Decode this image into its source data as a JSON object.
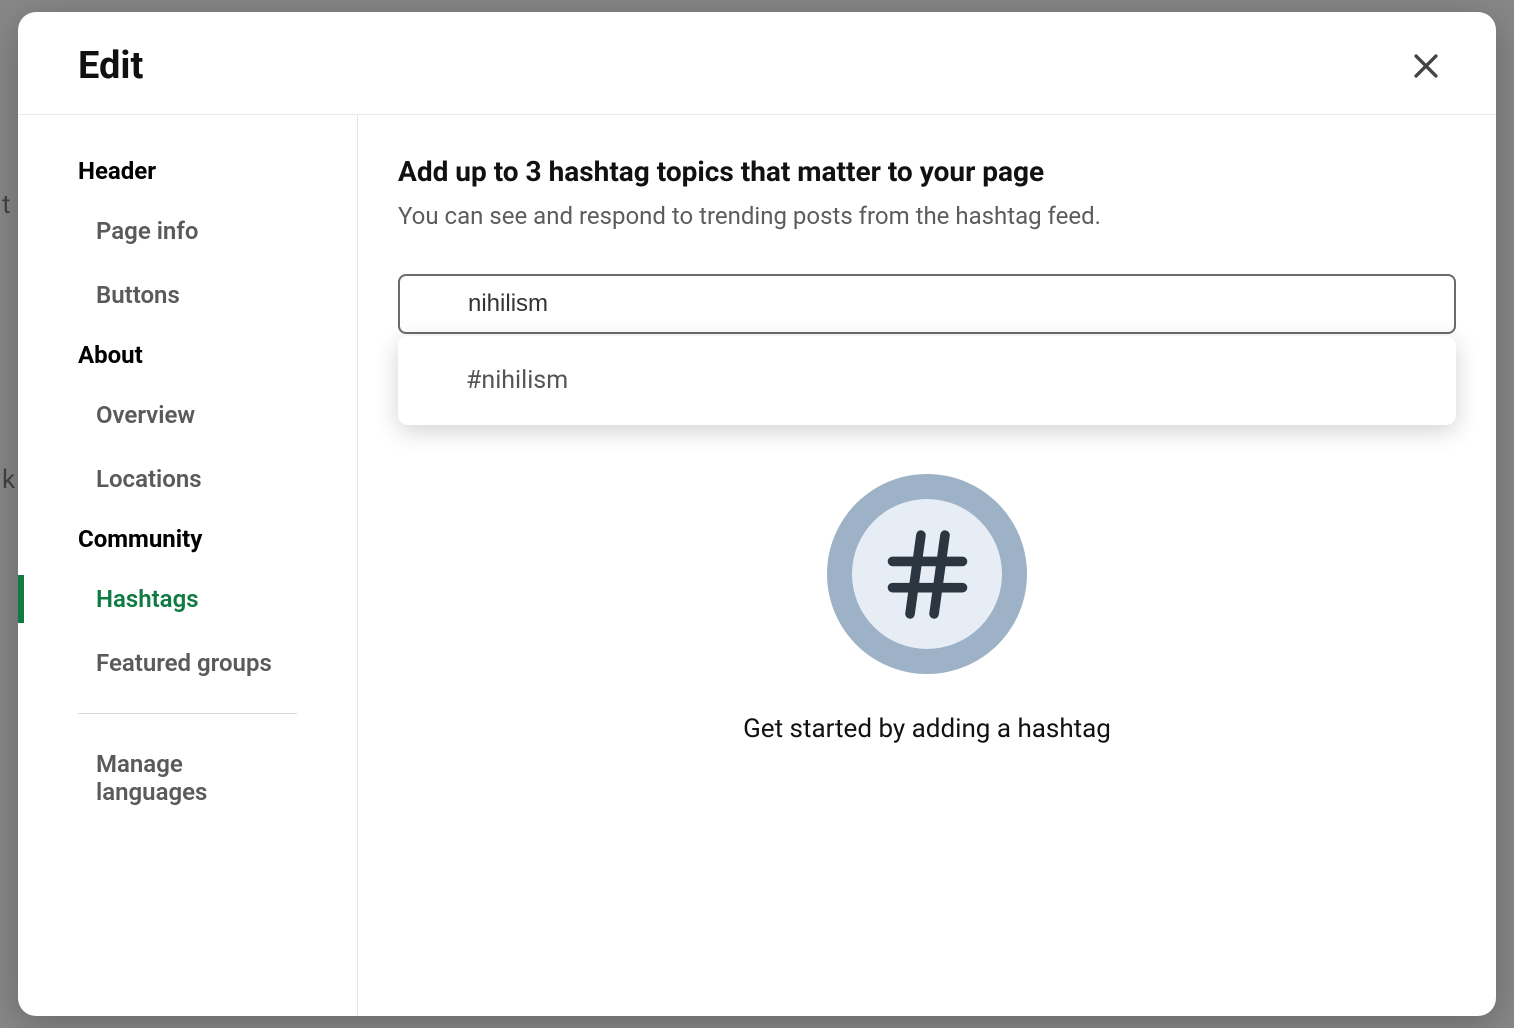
{
  "modal": {
    "title": "Edit"
  },
  "sidebar": {
    "sections": [
      {
        "header": "Header",
        "items": [
          {
            "label": "Page info",
            "active": false
          },
          {
            "label": "Buttons",
            "active": false
          }
        ]
      },
      {
        "header": "About",
        "items": [
          {
            "label": "Overview",
            "active": false
          },
          {
            "label": "Locations",
            "active": false
          }
        ]
      },
      {
        "header": "Community",
        "items": [
          {
            "label": "Hashtags",
            "active": true
          },
          {
            "label": "Featured groups",
            "active": false
          }
        ]
      }
    ],
    "footer_item": {
      "label": "Manage languages"
    }
  },
  "content": {
    "title": "Add up to 3 hashtag topics that matter to your page",
    "subtitle": "You can see and respond to trending posts from the hashtag feed.",
    "search_value": "nihilism",
    "suggestion": "#nihilism",
    "empty_text": "Get started by adding a hashtag"
  }
}
